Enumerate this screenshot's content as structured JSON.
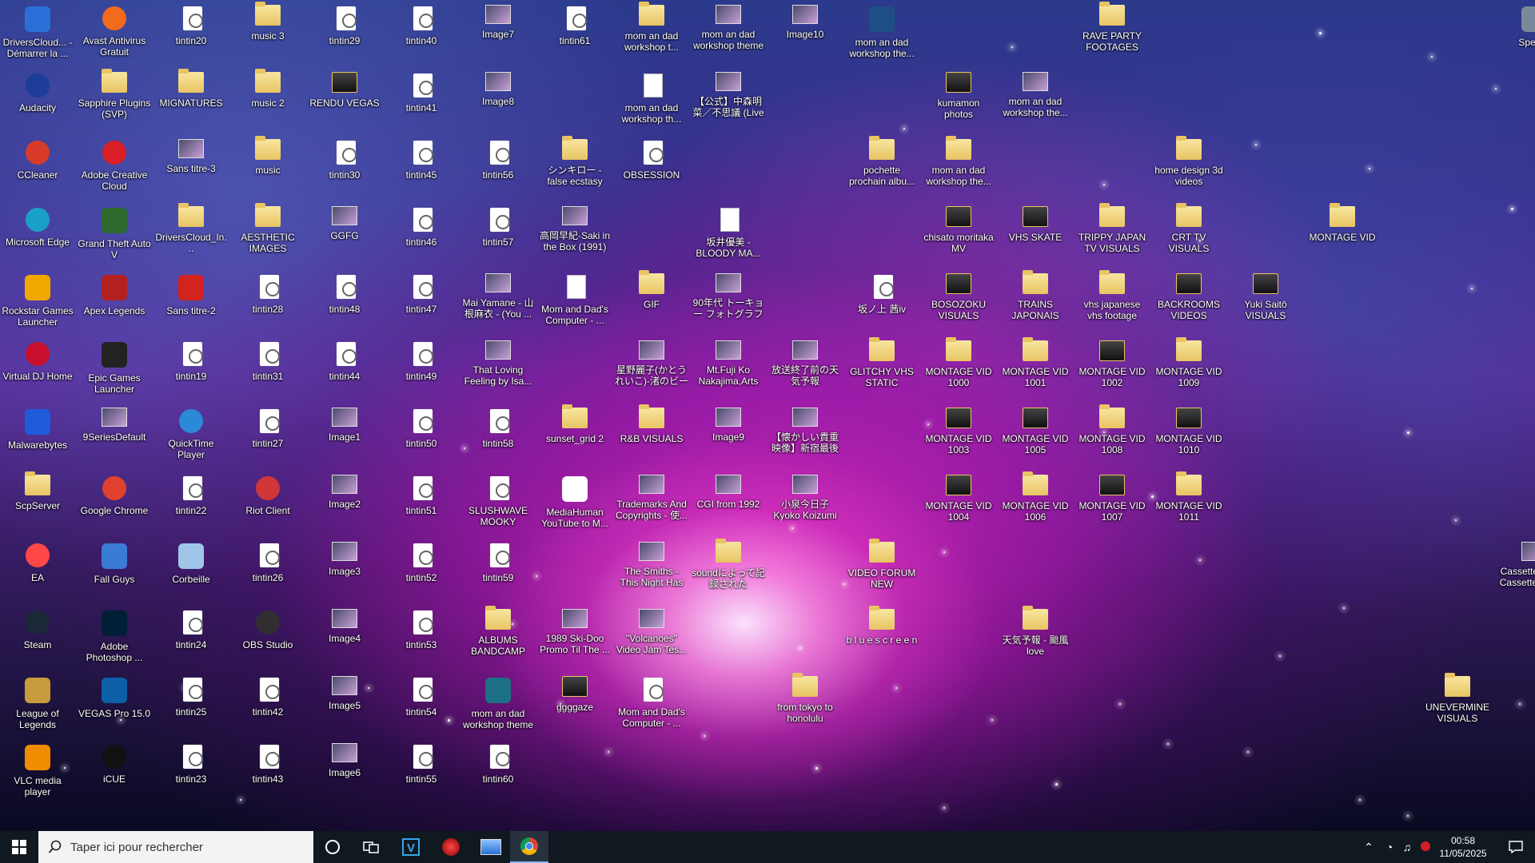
{
  "desktop_icons": [
    {
      "label": "DriversCloud... - Démarrer la ...",
      "kind": "app",
      "color": "#2a6fd8",
      "c": 0,
      "r": 0
    },
    {
      "label": "Avast Antivirus Gratuit",
      "kind": "round",
      "color": "#f26a1b",
      "c": 1,
      "r": 0
    },
    {
      "label": "tintin20",
      "kind": "file",
      "c": 2,
      "r": 0
    },
    {
      "label": "music 3",
      "kind": "folder",
      "c": 3,
      "r": 0
    },
    {
      "label": "tintin29",
      "kind": "file",
      "c": 4,
      "r": 0
    },
    {
      "label": "tintin40",
      "kind": "file",
      "c": 5,
      "r": 0
    },
    {
      "label": "Image7",
      "kind": "img",
      "c": 6,
      "r": 0
    },
    {
      "label": "tintin61",
      "kind": "file",
      "c": 7,
      "r": 0
    },
    {
      "label": "mom an dad workshop t...",
      "kind": "folder",
      "c": 8,
      "r": 0
    },
    {
      "label": "mom an dad workshop theme",
      "kind": "img",
      "c": 9,
      "r": 0
    },
    {
      "label": "Image10",
      "kind": "img",
      "c": 10,
      "r": 0
    },
    {
      "label": "mom an dad workshop the...",
      "kind": "app",
      "color": "#1d4f86",
      "c": 11,
      "r": 0
    },
    {
      "label": "RAVE PARTY FOOTAGES",
      "kind": "folder",
      "c": 14,
      "r": 0
    },
    {
      "label": "Speccy",
      "kind": "app",
      "color": "#7a8a9a",
      "c": 19.5,
      "r": 0
    },
    {
      "label": "Audacity",
      "kind": "round",
      "color": "#1e3c9a",
      "c": 0,
      "r": 1
    },
    {
      "label": "Sapphire Plugins (SVP)",
      "kind": "folder",
      "c": 1,
      "r": 1
    },
    {
      "label": "MIGNATURES",
      "kind": "folder",
      "c": 2,
      "r": 1
    },
    {
      "label": "music 2",
      "kind": "folder",
      "c": 3,
      "r": 1
    },
    {
      "label": "RENDU VEGAS",
      "kind": "folder-dark",
      "c": 4,
      "r": 1
    },
    {
      "label": "tintin41",
      "kind": "file",
      "c": 5,
      "r": 1
    },
    {
      "label": "Image8",
      "kind": "img",
      "c": 6,
      "r": 1
    },
    {
      "label": "mom an dad workshop th...",
      "kind": "doc",
      "c": 8,
      "r": 1
    },
    {
      "label": "【公式】中森明菜／不思議 (Live i...",
      "kind": "img",
      "c": 9,
      "r": 1
    },
    {
      "label": "kumamon photos",
      "kind": "folder-dark",
      "c": 12,
      "r": 1
    },
    {
      "label": "mom an dad workshop the...",
      "kind": "img",
      "c": 13,
      "r": 1
    },
    {
      "label": "CCleaner",
      "kind": "round",
      "color": "#d83a2a",
      "c": 0,
      "r": 2
    },
    {
      "label": "Adobe Creative Cloud",
      "kind": "round",
      "color": "#da1f26",
      "c": 1,
      "r": 2
    },
    {
      "label": "Sans titre-3",
      "kind": "img",
      "c": 2,
      "r": 2
    },
    {
      "label": "music",
      "kind": "folder",
      "c": 3,
      "r": 2
    },
    {
      "label": "tintin30",
      "kind": "file",
      "c": 4,
      "r": 2
    },
    {
      "label": "tintin45",
      "kind": "file",
      "c": 5,
      "r": 2
    },
    {
      "label": "tintin56",
      "kind": "file",
      "c": 6,
      "r": 2
    },
    {
      "label": "シンキロー - false ecstasy",
      "kind": "folder",
      "c": 7,
      "r": 2
    },
    {
      "label": "OBSESSION",
      "kind": "file",
      "c": 8,
      "r": 2
    },
    {
      "label": "pochette prochain albu...",
      "kind": "folder",
      "c": 11,
      "r": 2
    },
    {
      "label": "mom an dad workshop the...",
      "kind": "folder",
      "c": 12,
      "r": 2
    },
    {
      "label": "home design 3d videos",
      "kind": "folder",
      "c": 15,
      "r": 2
    },
    {
      "label": "Microsoft Edge",
      "kind": "round",
      "color": "#1aa0c8",
      "c": 0,
      "r": 3
    },
    {
      "label": "Grand Theft Auto V",
      "kind": "app",
      "color": "#2f6b2f",
      "c": 1,
      "r": 3
    },
    {
      "label": "DriversCloud_In...",
      "kind": "folder",
      "c": 2,
      "r": 3
    },
    {
      "label": "AESTHETIC IMAGES",
      "kind": "folder",
      "c": 3,
      "r": 3
    },
    {
      "label": "GGFG",
      "kind": "img",
      "c": 4,
      "r": 3
    },
    {
      "label": "tintin46",
      "kind": "file",
      "c": 5,
      "r": 3
    },
    {
      "label": "tintin57",
      "kind": "file",
      "c": 6,
      "r": 3
    },
    {
      "label": "高岡早紀-Saki in the Box (1991)",
      "kind": "img",
      "c": 7,
      "r": 3
    },
    {
      "label": "坂井優美 -BLOODY MA...",
      "kind": "doc",
      "c": 9,
      "r": 3
    },
    {
      "label": "chisato moritaka MV",
      "kind": "folder-dark",
      "c": 12,
      "r": 3
    },
    {
      "label": "VHS SKATE",
      "kind": "folder-dark",
      "c": 13,
      "r": 3
    },
    {
      "label": "TRIPPY JAPAN TV VISUALS",
      "kind": "folder",
      "c": 14,
      "r": 3
    },
    {
      "label": "CRT TV VISUALS",
      "kind": "folder",
      "c": 15,
      "r": 3
    },
    {
      "label": "MONTAGE VID",
      "kind": "folder",
      "c": 17,
      "r": 3
    },
    {
      "label": "Rockstar Games Launcher",
      "kind": "app",
      "color": "#f0a800",
      "c": 0,
      "r": 4
    },
    {
      "label": "Apex Legends",
      "kind": "app",
      "color": "#b32020",
      "c": 1,
      "r": 4
    },
    {
      "label": "Sans titre-2",
      "kind": "app",
      "color": "#d2231f",
      "c": 2,
      "r": 4
    },
    {
      "label": "tintin28",
      "kind": "file",
      "c": 3,
      "r": 4
    },
    {
      "label": "tintin48",
      "kind": "file",
      "c": 4,
      "r": 4
    },
    {
      "label": "tintin47",
      "kind": "file",
      "c": 5,
      "r": 4
    },
    {
      "label": "Mai Yamane - 山根麻衣 - (You ...",
      "kind": "img",
      "c": 6,
      "r": 4
    },
    {
      "label": "Mom and Dad's Computer - ...",
      "kind": "doc",
      "c": 7,
      "r": 4
    },
    {
      "label": "GIF",
      "kind": "folder",
      "c": 8,
      "r": 4
    },
    {
      "label": "90年代 トーキョー フォトグラファー ...",
      "kind": "img",
      "c": 9,
      "r": 4
    },
    {
      "label": "坂ノ上 茜iv",
      "kind": "file",
      "c": 11,
      "r": 4
    },
    {
      "label": "BOSOZOKU VISUALS",
      "kind": "folder-dark",
      "c": 12,
      "r": 4
    },
    {
      "label": "TRAINS JAPONAIS",
      "kind": "folder",
      "c": 13,
      "r": 4
    },
    {
      "label": "vhs japanese vhs footage",
      "kind": "folder",
      "c": 14,
      "r": 4
    },
    {
      "label": "BACKROOMS VIDEOS",
      "kind": "folder-dark",
      "c": 15,
      "r": 4
    },
    {
      "label": "Yuki Saitō VISUALS",
      "kind": "folder-dark",
      "c": 16,
      "r": 4
    },
    {
      "label": "Virtual DJ Home",
      "kind": "round",
      "color": "#c8102e",
      "c": 0,
      "r": 5
    },
    {
      "label": "Epic Games Launcher",
      "kind": "app",
      "color": "#222",
      "c": 1,
      "r": 5
    },
    {
      "label": "tintin19",
      "kind": "file",
      "c": 2,
      "r": 5
    },
    {
      "label": "tintin31",
      "kind": "file",
      "c": 3,
      "r": 5
    },
    {
      "label": "tintin44",
      "kind": "file",
      "c": 4,
      "r": 5
    },
    {
      "label": "tintin49",
      "kind": "file",
      "c": 5,
      "r": 5
    },
    {
      "label": "That Loving Feeling by Isa...",
      "kind": "img",
      "c": 6,
      "r": 5
    },
    {
      "label": "星野麗子(かとうれいこ)-渚のビーナ...",
      "kind": "img",
      "c": 8,
      "r": 5
    },
    {
      "label": "Mt.Fuji Ko Nakajima,Arts",
      "kind": "img",
      "c": 9,
      "r": 5
    },
    {
      "label": "放送終了前の天気予報",
      "kind": "img",
      "c": 10,
      "r": 5
    },
    {
      "label": "GLITCHY VHS STATIC",
      "kind": "folder",
      "c": 11,
      "r": 5
    },
    {
      "label": "MONTAGE VID 1000",
      "kind": "folder",
      "c": 12,
      "r": 5
    },
    {
      "label": "MONTAGE VID 1001",
      "kind": "folder",
      "c": 13,
      "r": 5
    },
    {
      "label": "MONTAGE VID 1002",
      "kind": "folder-dark",
      "c": 14,
      "r": 5
    },
    {
      "label": "MONTAGE VID 1009",
      "kind": "folder",
      "c": 15,
      "r": 5
    },
    {
      "label": "Malwarebytes",
      "kind": "app",
      "color": "#1f5bd8",
      "c": 0,
      "r": 6
    },
    {
      "label": "9SeriesDefault",
      "kind": "img",
      "c": 1,
      "r": 6
    },
    {
      "label": "QuickTime Player",
      "kind": "round",
      "color": "#2a8ad8",
      "c": 2,
      "r": 6
    },
    {
      "label": "tintin27",
      "kind": "file",
      "c": 3,
      "r": 6
    },
    {
      "label": "Image1",
      "kind": "img",
      "c": 4,
      "r": 6
    },
    {
      "label": "tintin50",
      "kind": "file",
      "c": 5,
      "r": 6
    },
    {
      "label": "tintin58",
      "kind": "file",
      "c": 6,
      "r": 6
    },
    {
      "label": "sunset_grid 2",
      "kind": "folder",
      "c": 7,
      "r": 6
    },
    {
      "label": "R&B VISUALS",
      "kind": "folder",
      "c": 8,
      "r": 6
    },
    {
      "label": "Image9",
      "kind": "img",
      "c": 9,
      "r": 6
    },
    {
      "label": "【懐かしい貴重映像】新宿最後の...",
      "kind": "img",
      "c": 10,
      "r": 6
    },
    {
      "label": "MONTAGE VID 1003",
      "kind": "folder-dark",
      "c": 12,
      "r": 6
    },
    {
      "label": "MONTAGE VID 1005",
      "kind": "folder-dark",
      "c": 13,
      "r": 6
    },
    {
      "label": "MONTAGE VID 1008",
      "kind": "folder",
      "c": 14,
      "r": 6
    },
    {
      "label": "MONTAGE VID 1010",
      "kind": "folder-dark",
      "c": 15,
      "r": 6
    },
    {
      "label": "ScpServer",
      "kind": "folder",
      "c": 0,
      "r": 7
    },
    {
      "label": "Google Chrome",
      "kind": "round",
      "color": "#e0412f",
      "c": 1,
      "r": 7
    },
    {
      "label": "tintin22",
      "kind": "file",
      "c": 2,
      "r": 7
    },
    {
      "label": "Riot Client",
      "kind": "round",
      "color": "#d13639",
      "c": 3,
      "r": 7
    },
    {
      "label": "Image2",
      "kind": "img",
      "c": 4,
      "r": 7
    },
    {
      "label": "tintin51",
      "kind": "file",
      "c": 5,
      "r": 7
    },
    {
      "label": "SLUSHWAVE MOOKY",
      "kind": "file",
      "c": 6,
      "r": 7
    },
    {
      "label": "MediaHuman YouTube to M...",
      "kind": "app",
      "color": "#ffffff",
      "c": 7,
      "r": 7
    },
    {
      "label": "Trademarks And Copyrights - 使...",
      "kind": "img",
      "c": 8,
      "r": 7
    },
    {
      "label": "CGI from 1992",
      "kind": "img",
      "c": 9,
      "r": 7
    },
    {
      "label": "小泉今日子 Kyoko Koizumi ...",
      "kind": "img",
      "c": 10,
      "r": 7
    },
    {
      "label": "MONTAGE VID 1004",
      "kind": "folder-dark",
      "c": 12,
      "r": 7
    },
    {
      "label": "MONTAGE VID 1006",
      "kind": "folder",
      "c": 13,
      "r": 7
    },
    {
      "label": "MONTAGE VID 1007",
      "kind": "folder-dark",
      "c": 14,
      "r": 7
    },
    {
      "label": "MONTAGE VID 1011",
      "kind": "folder",
      "c": 15,
      "r": 7
    },
    {
      "label": "EA",
      "kind": "round",
      "color": "#ff4747",
      "c": 0,
      "r": 8
    },
    {
      "label": "Fall Guys",
      "kind": "app",
      "color": "#3a7bd5",
      "c": 1,
      "r": 8
    },
    {
      "label": "Corbeille",
      "kind": "app",
      "color": "#9fc6e8",
      "c": 2,
      "r": 8
    },
    {
      "label": "tintin26",
      "kind": "file",
      "c": 3,
      "r": 8
    },
    {
      "label": "Image3",
      "kind": "img",
      "c": 4,
      "r": 8
    },
    {
      "label": "tintin52",
      "kind": "file",
      "c": 5,
      "r": 8
    },
    {
      "label": "tintin59",
      "kind": "file",
      "c": 6,
      "r": 8
    },
    {
      "label": "The Smiths - This Night Has Ope...",
      "kind": "img",
      "c": 8,
      "r": 8
    },
    {
      "label": "soundによって記録された",
      "kind": "folder",
      "c": 9,
      "r": 8
    },
    {
      "label": "VIDEO FORUM NEW",
      "kind": "folder",
      "c": 11,
      "r": 8
    },
    {
      "label": "Cassette Player Cassette Tape...",
      "kind": "img",
      "c": 19.5,
      "r": 8
    },
    {
      "label": "Steam",
      "kind": "round",
      "color": "#1b2838",
      "c": 0,
      "r": 9
    },
    {
      "label": "Adobe Photoshop ...",
      "kind": "app",
      "color": "#001e36",
      "c": 1,
      "r": 9
    },
    {
      "label": "tintin24",
      "kind": "file",
      "c": 2,
      "r": 9
    },
    {
      "label": "OBS Studio",
      "kind": "round",
      "color": "#302e31",
      "c": 3,
      "r": 9
    },
    {
      "label": "Image4",
      "kind": "img",
      "c": 4,
      "r": 9
    },
    {
      "label": "tintin53",
      "kind": "file",
      "c": 5,
      "r": 9
    },
    {
      "label": "ALBUMS BANDCAMP",
      "kind": "folder",
      "c": 6,
      "r": 9
    },
    {
      "label": "1989 Ski-Doo Promo Til The ...",
      "kind": "img",
      "c": 7,
      "r": 9
    },
    {
      "label": "\"Volcanoes\" Video Jam Tes...",
      "kind": "img",
      "c": 8,
      "r": 9
    },
    {
      "label": "b l u e s c r e e n",
      "kind": "folder",
      "c": 11,
      "r": 9
    },
    {
      "label": "天気予報 - 颱風 love",
      "kind": "folder",
      "c": 13,
      "r": 9
    },
    {
      "label": "League of Legends",
      "kind": "app",
      "color": "#c89b3c",
      "c": 0,
      "r": 10
    },
    {
      "label": "VEGAS Pro 15.0",
      "kind": "app",
      "color": "#0d5fa8",
      "c": 1,
      "r": 10
    },
    {
      "label": "tintin25",
      "kind": "file",
      "c": 2,
      "r": 10
    },
    {
      "label": "tintin42",
      "kind": "file",
      "c": 3,
      "r": 10
    },
    {
      "label": "Image5",
      "kind": "img",
      "c": 4,
      "r": 10
    },
    {
      "label": "tintin54",
      "kind": "file",
      "c": 5,
      "r": 10
    },
    {
      "label": "mom an dad workshop theme",
      "kind": "app",
      "color": "#1d6f86",
      "c": 6,
      "r": 10
    },
    {
      "label": "ggggaze",
      "kind": "folder-dark",
      "c": 7,
      "r": 10
    },
    {
      "label": "Mom and Dad's Computer - ...",
      "kind": "file",
      "c": 8,
      "r": 10
    },
    {
      "label": "from tokyo to honolulu",
      "kind": "folder",
      "c": 10,
      "r": 10
    },
    {
      "label": "UNEVERMINE VISUALS",
      "kind": "folder",
      "c": 18.5,
      "r": 10
    },
    {
      "label": "VLC media player",
      "kind": "app",
      "color": "#f08c00",
      "c": 0,
      "r": 11
    },
    {
      "label": "iCUE",
      "kind": "round",
      "color": "#111111",
      "c": 1,
      "r": 11
    },
    {
      "label": "tintin23",
      "kind": "file",
      "c": 2,
      "r": 11
    },
    {
      "label": "tintin43",
      "kind": "file",
      "c": 3,
      "r": 11
    },
    {
      "label": "Image6",
      "kind": "img",
      "c": 4,
      "r": 11
    },
    {
      "label": "tintin55",
      "kind": "file",
      "c": 5,
      "r": 11
    },
    {
      "label": "tintin60",
      "kind": "file",
      "c": 6,
      "r": 11
    }
  ],
  "taskbar": {
    "search_placeholder": "Taper ici pour rechercher",
    "pinned": [
      "cortana-icon",
      "task-view-icon",
      "vegas-icon",
      "virtual-dj-icon",
      "file-manager-icon",
      "chrome-icon"
    ],
    "time": "00:58",
    "date": "11/05/2025"
  },
  "colors": {
    "taskbar": "#101820",
    "accent": "#e23fd0"
  }
}
